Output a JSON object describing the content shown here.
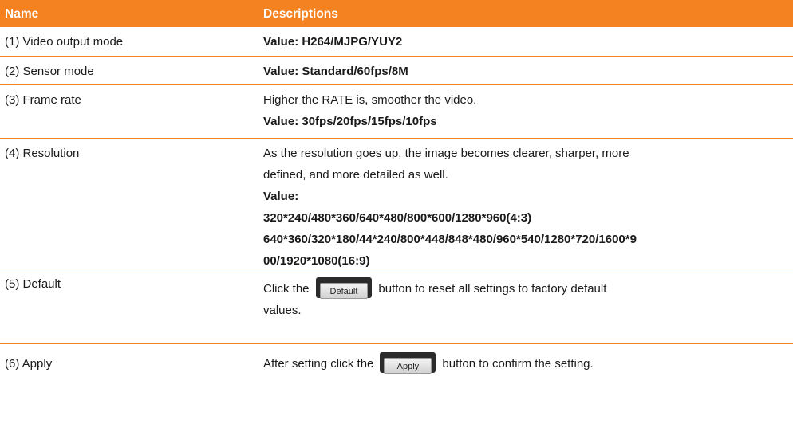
{
  "header": {
    "name": "Name",
    "descriptions": "Descriptions"
  },
  "rows": [
    {
      "name": "(1) Video output mode",
      "value": "Value: H264/MJPG/YUY2"
    },
    {
      "name": "(2) Sensor mode",
      "value": "Value: Standard/60fps/8M"
    },
    {
      "name": "(3) Frame rate",
      "desc": "Higher the RATE is, smoother the video.",
      "value": "Value: 30fps/20fps/15fps/10fps"
    },
    {
      "name": "(4) Resolution",
      "desc_line1": "As the resolution goes up, the image becomes clearer, sharper, more",
      "desc_line2": "defined, and more detailed as well.",
      "value_label": "Value:",
      "value_line1": "320*240/480*360/640*480/800*600/1280*960(4:3)",
      "value_line2": "640*360/320*180/44*240/800*448/848*480/960*540/1280*720/1600*9",
      "value_line3": "00/1920*1080(16:9)"
    },
    {
      "name": "(5) Default",
      "desc_before": "Click the",
      "button_label": "Default",
      "desc_after": "button to reset all settings to factory default",
      "desc_line2": "values."
    },
    {
      "name": "(6) Apply",
      "desc_before": "After setting click the",
      "button_label": "Apply",
      "desc_after": "button to confirm the setting."
    }
  ],
  "colors": {
    "accent": "#f58220",
    "header_text": "#ffffff",
    "button_frame": "#2b2b2b"
  }
}
